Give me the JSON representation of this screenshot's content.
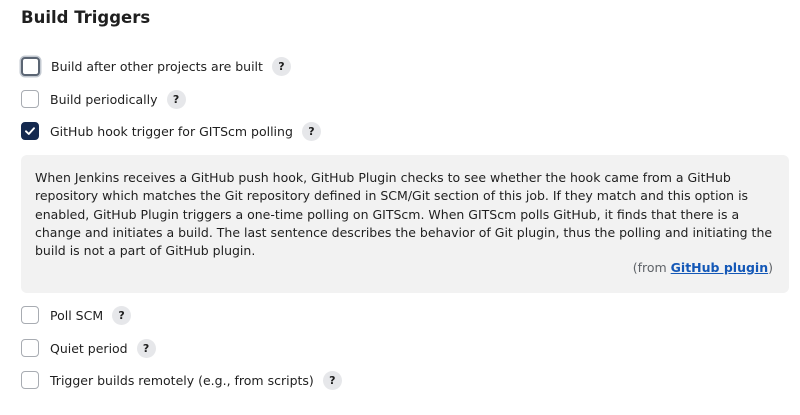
{
  "section": {
    "title": "Build Triggers"
  },
  "triggers": [
    {
      "label": "Build after other projects are built",
      "checked": false,
      "focused": true
    },
    {
      "label": "Build periodically",
      "checked": false
    },
    {
      "label": "GitHub hook trigger for GITScm polling",
      "checked": true
    },
    {
      "label": "Poll SCM",
      "checked": false
    },
    {
      "label": "Quiet period",
      "checked": false
    },
    {
      "label": "Trigger builds remotely (e.g., from scripts)",
      "checked": false
    }
  ],
  "help_icon": "?",
  "help_panel": {
    "text": "When Jenkins receives a GitHub push hook, GitHub Plugin checks to see whether the hook came from a GitHub repository which matches the Git repository defined in SCM/Git section of this job. If they match and this option is enabled, GitHub Plugin triggers a one-time polling on GITScm. When GITScm polls GitHub, it finds that there is a change and initiates a build. The last sentence describes the behavior of Git plugin, thus the polling and initiating the build is not a part of GitHub plugin.",
    "source_prefix": "(from ",
    "source_link": "GitHub plugin",
    "source_suffix": ")"
  },
  "colors": {
    "checked_fill": "#14294f",
    "link": "#1458b7",
    "panel_background": "#f2f2f2"
  }
}
